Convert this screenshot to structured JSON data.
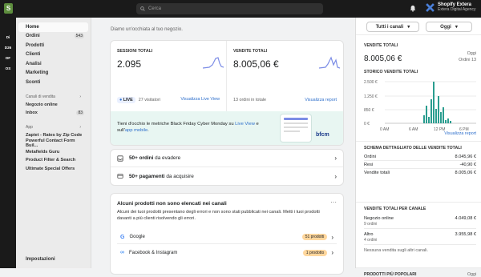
{
  "topbar": {
    "search_placeholder": "Cerca",
    "store_name": "Shopify Extera",
    "store_sub": "Extera Digital Agency"
  },
  "rail": [
    "Di",
    "D26",
    "DF",
    "OS"
  ],
  "sidebar": {
    "items": [
      {
        "label": "Home"
      },
      {
        "label": "Ordini",
        "badge": "543"
      },
      {
        "label": "Prodotti"
      },
      {
        "label": "Clienti"
      },
      {
        "label": "Analisi"
      },
      {
        "label": "Marketing"
      },
      {
        "label": "Sconti"
      }
    ],
    "channels_head": "Canali di vendita",
    "channels": [
      {
        "label": "Negozio online"
      },
      {
        "label": "Inbox",
        "badge": "83"
      }
    ],
    "apps_head": "App",
    "apps": [
      {
        "label": "Zapiet - Rates by Zip Code"
      },
      {
        "label": "Powerful Contact Form Buil..."
      },
      {
        "label": "Metafields Guru"
      },
      {
        "label": "Product Filter & Search"
      },
      {
        "label": "Ultimate Special Offers"
      }
    ],
    "settings": "Impostazioni"
  },
  "main": {
    "greeting": "Diamo un'occhiata al tuo negozio.",
    "sessions": {
      "title": "SESSIONI TOTALI",
      "value": "2.095",
      "live": "LIVE",
      "visitors": "27 visitatori",
      "link": "Visualizza Live View"
    },
    "sales": {
      "title": "VENDITE TOTALI",
      "value": "8.005,06 €",
      "sub": "13 ordini in totale",
      "link": "Visualizza report"
    },
    "banner": {
      "text1": "Tieni d'occhio le metriche Black Friday Cyber Monday su ",
      "link1": "Live View",
      "text2": " e sull'",
      "link2": "app mobile",
      "text3": ".",
      "brand": "bfcm"
    },
    "tasks": [
      {
        "bold": "50+ ordini",
        "rest": " da evadere"
      },
      {
        "bold": "50+ pagamenti",
        "rest": " da acquisire"
      }
    ],
    "products_card": {
      "title": "Alcuni prodotti non sono elencati nei canali",
      "desc": "Alcuni dei tuoi prodotti presentano degli errori e non sono stati pubblicati nei canali. Metti i tuoi prodotti davanti a più clienti risolvendo gli errori.",
      "rows": [
        {
          "label": "Google",
          "badge": "51 prodotti"
        },
        {
          "label": "Facebook & Instagram",
          "badge": "1 prodotto"
        }
      ]
    }
  },
  "right": {
    "channels_btn": "Tutti i canali",
    "date_btn": "Oggi",
    "total": {
      "title": "VENDITE TOTALI",
      "value": "8.005,06 €",
      "today": "Oggi",
      "orders": "Ordini 13"
    },
    "history": {
      "title": "STORICO VENDITE TOTALI",
      "yticks": [
        "2.500 €",
        "1.250 €",
        "850 €",
        "0 €"
      ],
      "xticks": [
        "0 AM",
        "6 AM",
        "12 PM",
        "6 PM"
      ],
      "link": "Visualizza report",
      "values": [
        0,
        0,
        0,
        0,
        0,
        0,
        0,
        0,
        0,
        0,
        0,
        0,
        0,
        0,
        0,
        0,
        0,
        0,
        0,
        0,
        0,
        0,
        0,
        0,
        0,
        0,
        0,
        0,
        0,
        0,
        0,
        0,
        0,
        0,
        0,
        0,
        0,
        0,
        0,
        0,
        0,
        0,
        0,
        0,
        0,
        0,
        0,
        0,
        0,
        0,
        0,
        0,
        0,
        0,
        0,
        0,
        0,
        0,
        0,
        0,
        0,
        0,
        0,
        0,
        0,
        0,
        0,
        0,
        0,
        0,
        0,
        0,
        0,
        0,
        0,
        0,
        0,
        0,
        0,
        0
      ]
    },
    "breakdown": {
      "title": "SCHEMA DETTAGLIATO DELLE VENDITE TOTALI",
      "rows": [
        {
          "label": "Ordini",
          "value": "8.045,96 €"
        },
        {
          "label": "Resi",
          "value": "-40,90 €"
        },
        {
          "label": "Vendite totali",
          "value": "8.005,06 €"
        }
      ]
    },
    "bychannel": {
      "title": "VENDITE TOTALI PER CANALE",
      "rows": [
        {
          "label": "Negozio online",
          "value": "4.049,08 €",
          "sub": "9 ordini"
        },
        {
          "label": "Altro",
          "value": "3.955,98 €",
          "sub": "4 ordini"
        }
      ],
      "note": "Nessuna vendita sugli altri canali."
    },
    "popular": {
      "title": "PRODOTTI PIÙ POPOLARI",
      "range": "Oggi"
    }
  }
}
